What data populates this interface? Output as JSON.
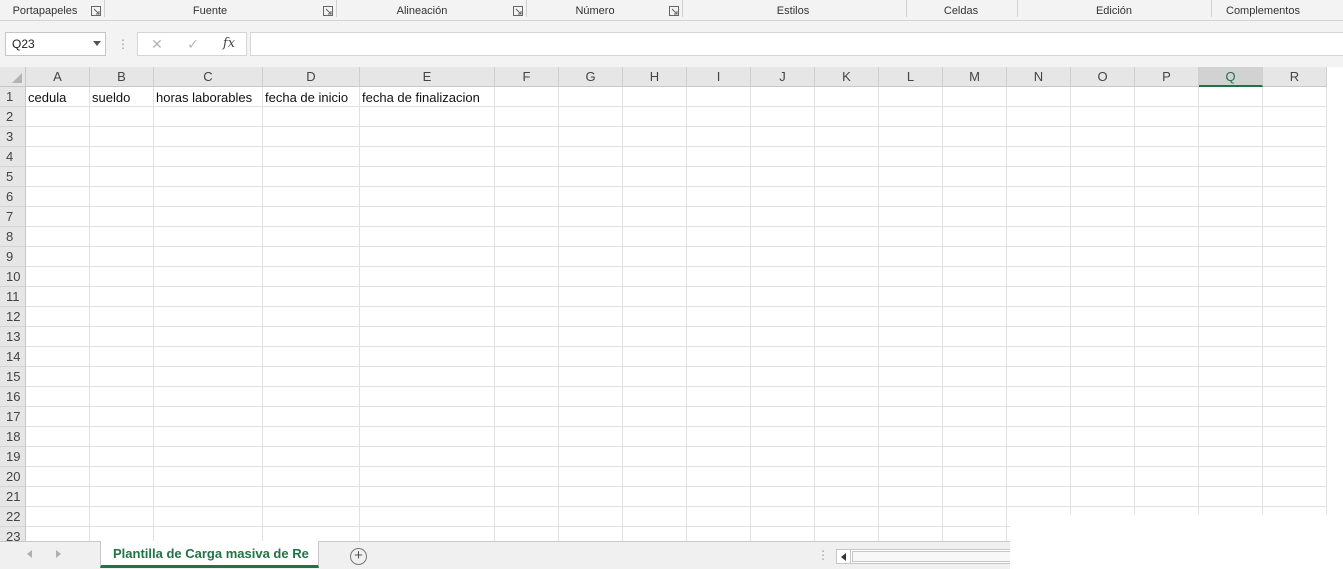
{
  "ribbon": {
    "groups": [
      {
        "label": "Portapapeles",
        "launcher": true
      },
      {
        "label": "Fuente",
        "launcher": true
      },
      {
        "label": "Alineación",
        "launcher": true
      },
      {
        "label": "Número",
        "launcher": true
      },
      {
        "label": "Estilos",
        "launcher": false
      },
      {
        "label": "Celdas",
        "launcher": false
      },
      {
        "label": "Edición",
        "launcher": false
      },
      {
        "label": "Complementos",
        "launcher": false
      }
    ]
  },
  "formula_bar": {
    "name_box": "Q23",
    "cancel_icon": "✕",
    "enter_icon": "✓",
    "fx_label": "fx",
    "formula": ""
  },
  "sheet": {
    "columns": [
      "A",
      "B",
      "C",
      "D",
      "E",
      "F",
      "G",
      "H",
      "I",
      "J",
      "K",
      "L",
      "M",
      "N",
      "O",
      "P",
      "Q",
      "R"
    ],
    "selected_column": "Q",
    "rows": [
      "1",
      "2",
      "3",
      "4",
      "5",
      "6",
      "7",
      "8",
      "9",
      "10",
      "11",
      "12",
      "13",
      "14",
      "15",
      "16",
      "17",
      "18",
      "19",
      "20",
      "21",
      "22",
      "23"
    ],
    "row1": {
      "A": "cedula",
      "B": "sueldo",
      "C": "horas laborables",
      "D": "fecha de inicio",
      "E": "fecha de finalizacion"
    }
  },
  "tabs": {
    "active_sheet": "Plantilla de Carga masiva de Re",
    "add_sheet_symbol": "+"
  },
  "colors": {
    "accent": "#217346",
    "header_bg": "#e6e6e6",
    "gridline": "#e1e1e1"
  }
}
